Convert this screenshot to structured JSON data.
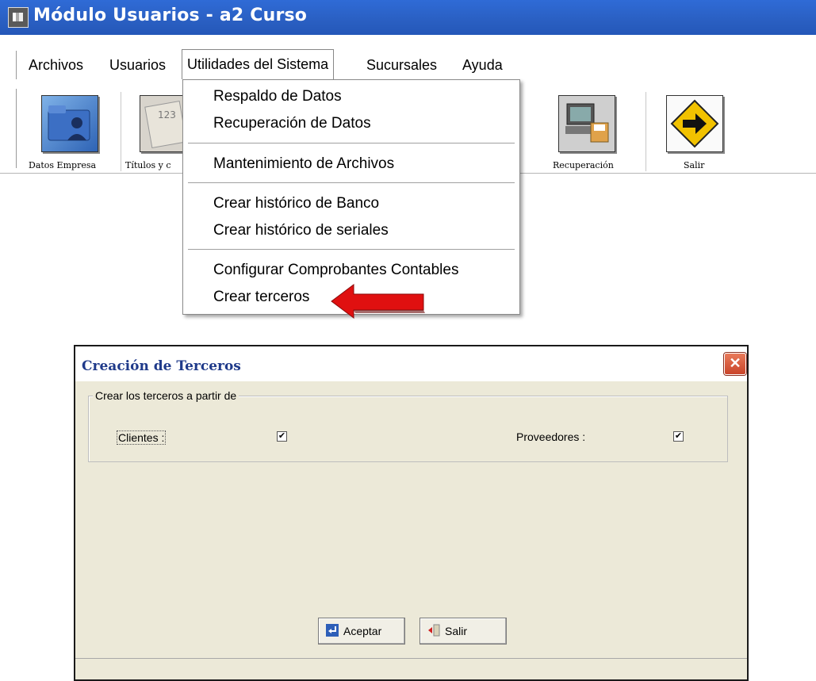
{
  "window": {
    "title": "Módulo Usuarios - a2 Curso"
  },
  "menubar": {
    "items": [
      "Archivos",
      "Usuarios",
      "Utilidades del Sistema",
      "Sucursales",
      "Ayuda"
    ],
    "active": "Utilidades del Sistema"
  },
  "toolbar": {
    "buttons": [
      {
        "label": "Datos Empresa",
        "icon": "folder-user-icon"
      },
      {
        "label": "Títulos y c",
        "icon": "numbers-icon"
      },
      {
        "label": "Recuperación",
        "icon": "computer-disk-icon"
      },
      {
        "label": "Salir",
        "icon": "exit-arrow-icon"
      }
    ]
  },
  "dropdown": {
    "items": [
      "Respaldo de Datos",
      "Recuperación de Datos",
      "Mantenimiento de Archivos",
      "Crear histórico de Banco",
      "Crear histórico de seriales",
      "Configurar Comprobantes Contables",
      "Crear terceros"
    ],
    "highlighted": "Crear terceros"
  },
  "colors": {
    "title_bar": "#2a5fc2",
    "dialog_bg": "#ece9d8",
    "arrow": "#e01010",
    "dialog_title": "#1f3a8a"
  },
  "dialog": {
    "title": "Creación de Terceros",
    "group_label": "Crear los terceros a partir de",
    "clientes_label": "Clientes :",
    "clientes_checked": true,
    "proveedores_label": "Proveedores :",
    "proveedores_checked": true,
    "accept_label": "Aceptar",
    "exit_label": "Salir",
    "check_glyph": "✔",
    "close_glyph": "✕"
  }
}
